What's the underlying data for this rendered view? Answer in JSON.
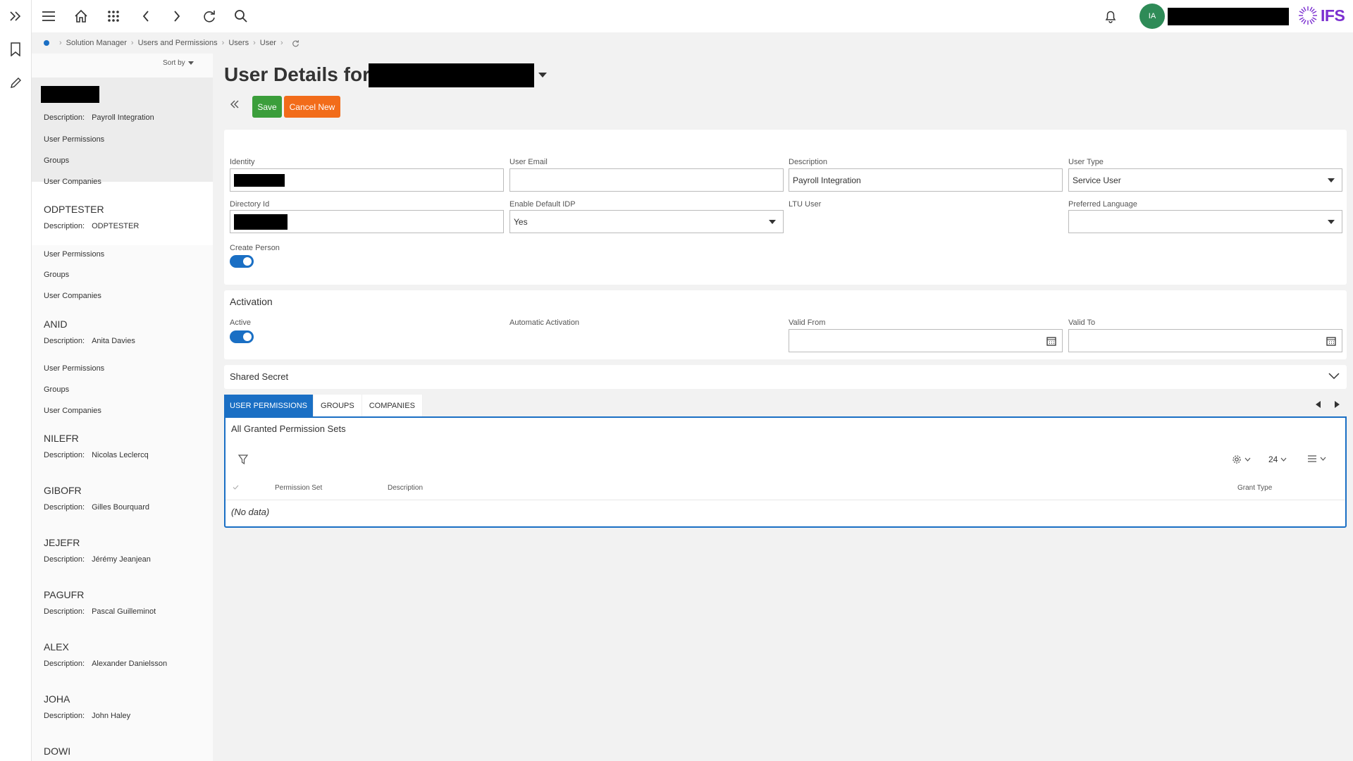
{
  "breadcrumb": [
    "Solution Manager",
    "Users and Permissions",
    "Users",
    "User"
  ],
  "avatar_initials": "IA",
  "brand": {
    "name": "IFS",
    "color": "#7b2fd0"
  },
  "colors": {
    "accent": "#1a6fc4",
    "save": "#3b9e3b",
    "cancel": "#f26c1a",
    "avatar": "#2e8b57"
  },
  "list": {
    "sort_label": "Sort by",
    "desc_label": "Description:",
    "link_labels": [
      "User Permissions",
      "Groups",
      "User Companies"
    ],
    "selected": {
      "title": "",
      "description": "Payroll Integration"
    },
    "items": [
      {
        "title": "ODPTESTER",
        "description": "ODPTESTER"
      },
      {
        "title": "ANID",
        "description": "Anita Davies"
      },
      {
        "title": "NILEFR",
        "description": "Nicolas Leclercq"
      },
      {
        "title": "GIBOFR",
        "description": "Gilles Bourquard"
      },
      {
        "title": "JEJEFR",
        "description": "Jérémy Jeanjean"
      },
      {
        "title": "PAGUFR",
        "description": "Pascal Guilleminot"
      },
      {
        "title": "ALEX",
        "description": "Alexander Danielsson"
      },
      {
        "title": "JOHA",
        "description": "John Haley"
      },
      {
        "title": "DOWI",
        "description": ""
      }
    ]
  },
  "page": {
    "title": "User Details for"
  },
  "actions": {
    "save": "Save",
    "cancel_new": "Cancel New"
  },
  "details": {
    "identity_label": "Identity",
    "user_email_label": "User Email",
    "user_email_value": "",
    "description_label": "Description",
    "description_value": "Payroll Integration",
    "user_type_label": "User Type",
    "user_type_value": "Service User",
    "directory_id_label": "Directory Id",
    "enable_default_idp_label": "Enable Default IDP",
    "enable_default_idp_value": "Yes",
    "ltu_user_label": "LTU User",
    "preferred_language_label": "Preferred Language",
    "preferred_language_value": "",
    "create_person_label": "Create Person",
    "create_person_on": true
  },
  "activation": {
    "title": "Activation",
    "active_label": "Active",
    "active_on": true,
    "automatic_activation_label": "Automatic Activation",
    "valid_from_label": "Valid From",
    "valid_to_label": "Valid To"
  },
  "shared_secret": {
    "title": "Shared Secret"
  },
  "tabs": [
    "USER PERMISSIONS",
    "GROUPS",
    "COMPANIES"
  ],
  "grid": {
    "title": "All Granted Permission Sets",
    "page_size": "24",
    "columns": [
      "Permission Set",
      "Description",
      "Grant Type"
    ],
    "empty_text": "(No data)"
  }
}
